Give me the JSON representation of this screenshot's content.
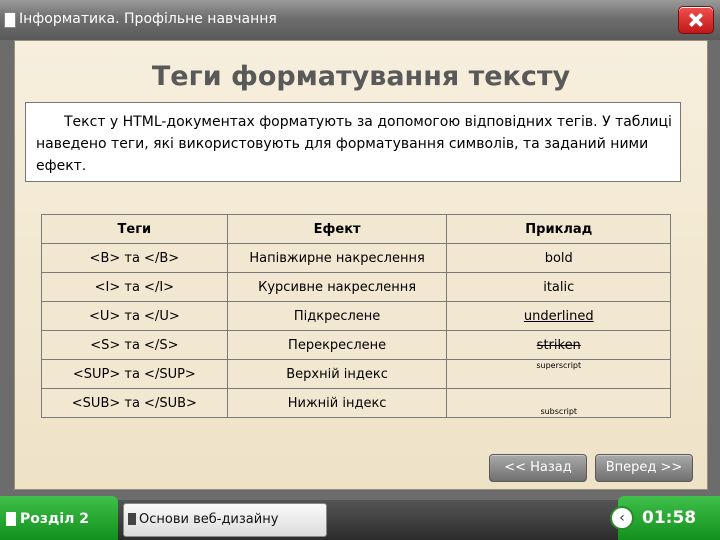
{
  "window": {
    "title": "Інформатика. Профільне навчання"
  },
  "slide": {
    "heading": "Теги форматування тексту",
    "intro_text": "Текст у HTML-документах форматують за допомогою відповідних тегів. У таблиці наведено теги, які використовують для форматування символів, та заданий ними ефект."
  },
  "table": {
    "headers": [
      "Теги",
      "Ефект",
      "Приклад"
    ],
    "rows": [
      {
        "tags": "<B> та </B>",
        "effect": "Напівжирне накреслення",
        "example": "bold"
      },
      {
        "tags": "<I> та </I>",
        "effect": "Курсивне накреслення",
        "example": "italic"
      },
      {
        "tags": "<U> та </U>",
        "effect": "Підкреслене",
        "example": "underlined"
      },
      {
        "tags": "<S> та </S>",
        "effect": "Перекреслене",
        "example": "striken"
      },
      {
        "tags": "<SUP> та </SUP>",
        "effect": "Верхній індекс",
        "example": "superscript"
      },
      {
        "tags": "<SUB> та </SUB>",
        "effect": "Нижній індекс",
        "example": "subscript"
      }
    ]
  },
  "nav": {
    "back_label": "<< Назад",
    "forward_label": "Вперед >>"
  },
  "footer": {
    "section_label": "Розділ 2",
    "topic_label": "Основи веб-дизайну",
    "timer": "01:58"
  },
  "colors": {
    "accent_green": "#1fa22a",
    "close_red": "#d22a2a"
  },
  "icons": [
    "document-icon",
    "close-icon",
    "back-arrow-icon"
  ]
}
